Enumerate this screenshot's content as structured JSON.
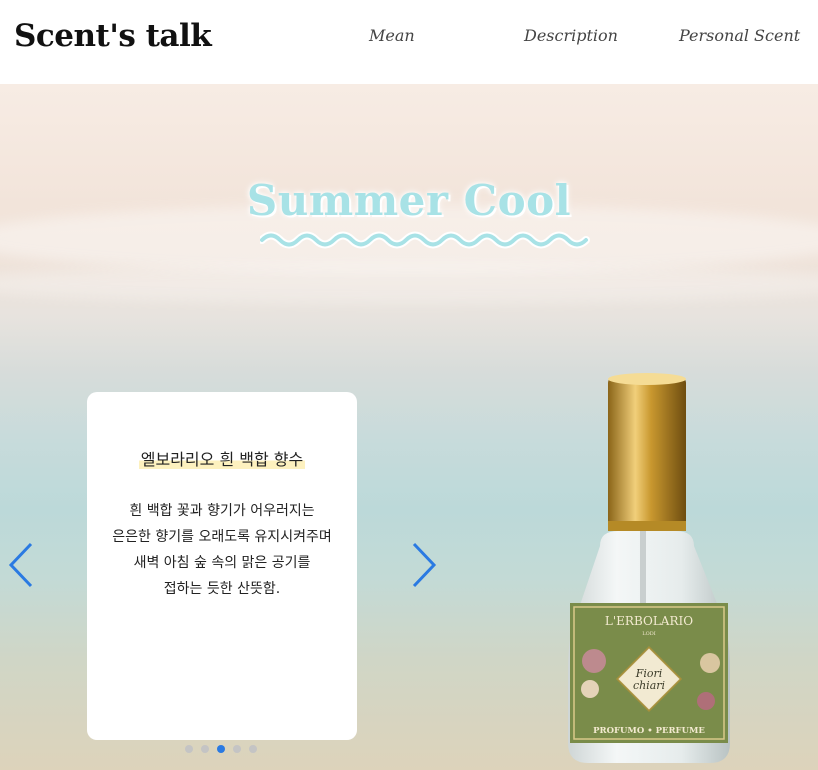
{
  "header": {
    "logo": "Scent's talk",
    "nav": [
      "Mean",
      "Description",
      "Personal Scent"
    ]
  },
  "hero": {
    "title": "Summer Cool",
    "card": {
      "title": "엘보라리오 흰 백합 향수",
      "description_lines": [
        "흰 백합 꽃과 향기가 어우러지는",
        "은은한 향기를 오래도록 유지시켜주며",
        "새벽 아침 숲 속의 맑은 공기를",
        "접하는 듯한 산뜻함."
      ]
    },
    "slider": {
      "slide_count": 5,
      "active_index": 2
    },
    "bottle": {
      "brand": "L'ERBOLARIO",
      "sub_brand": "LODI",
      "label_line1": "Fiori",
      "label_line2": "chiari",
      "footer": "PROFUMO • PERFUME"
    }
  },
  "colors": {
    "title": "#a8e2e6",
    "arrow": "#2a7ae2",
    "dot_active": "#2a7ae2",
    "dot_inactive": "#c4c4c4",
    "highlight": "#fdf1bf"
  },
  "icons": {
    "prev": "chevron-left-icon",
    "next": "chevron-right-icon"
  }
}
